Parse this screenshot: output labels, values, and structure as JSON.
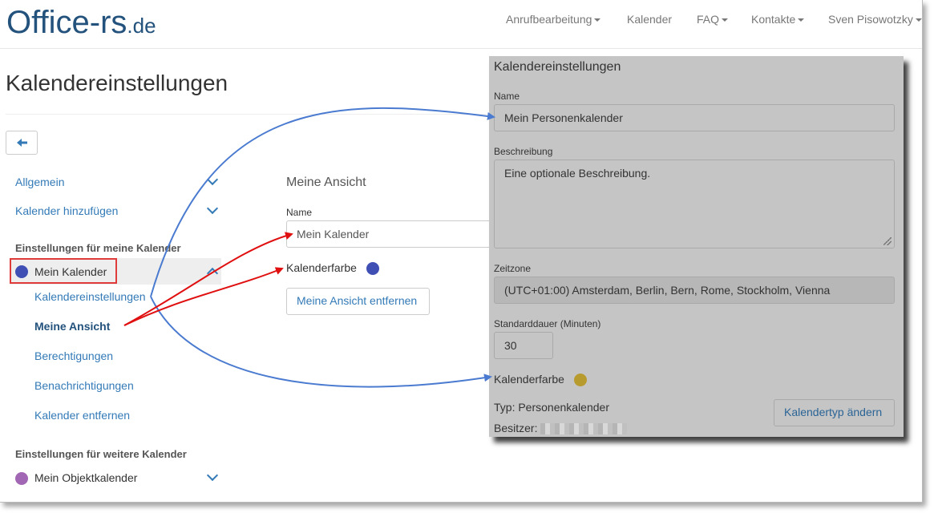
{
  "brand": {
    "name": "Office-rs",
    "domain": ".de"
  },
  "nav": {
    "items": [
      "Anrufbearbeitung",
      "Kalender",
      "FAQ",
      "Kontakte",
      "Sven Pisowotzky"
    ]
  },
  "page_title": "Kalendereinstellungen",
  "sidebar": {
    "allgemein": "Allgemein",
    "kalender_hinzufuegen": "Kalender hinzufügen",
    "section_mine": "Einstellungen für meine Kalender",
    "mein_kalender": "Mein Kalender",
    "sub": [
      "Kalendereinstellungen",
      "Meine Ansicht",
      "Berechtigungen",
      "Benachrichtigungen",
      "Kalender entfernen"
    ],
    "section_more": "Einstellungen für weitere Kalender",
    "objektkalender": "Mein Objektkalender"
  },
  "view": {
    "heading": "Meine Ansicht",
    "name_label": "Name",
    "name_value": "Mein Kalender",
    "color_label": "Kalenderfarbe",
    "remove_button": "Meine Ansicht entfernen"
  },
  "panel": {
    "heading": "Kalendereinstellungen",
    "name_label": "Name",
    "name_value": "Mein Personenkalender",
    "desc_label": "Beschreibung",
    "desc_value": "Eine optionale Beschreibung.",
    "tz_label": "Zeitzone",
    "tz_value": "(UTC+01:00) Amsterdam, Berlin, Bern, Rome, Stockholm, Vienna",
    "dur_label": "Standarddauer (Minuten)",
    "dur_value": "30",
    "color_label": "Kalenderfarbe",
    "type_text": "Typ: Personenkalender",
    "owner_label": "Besitzer:",
    "type_button": "Kalendertyp ändern"
  },
  "colors": {
    "link": "#337ab7",
    "mein_kalender_dot": "#3f4fb4",
    "objekt_dot": "#a267b4",
    "panel_color_dot": "#b89b2e",
    "annotation_blue": "#4a7bd0",
    "annotation_red": "#e01010"
  },
  "icons": {
    "back": "arrow-left-icon",
    "chevron": "chevron-down-icon"
  }
}
